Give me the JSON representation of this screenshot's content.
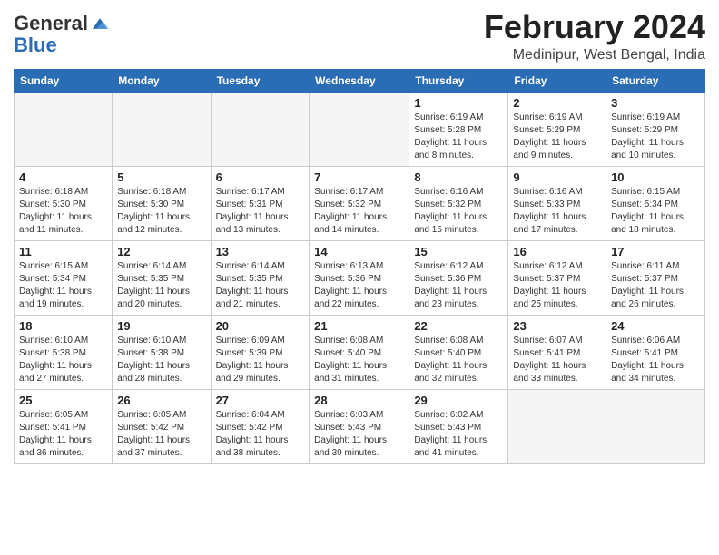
{
  "logo": {
    "general": "General",
    "blue": "Blue"
  },
  "title": "February 2024",
  "subtitle": "Medinipur, West Bengal, India",
  "days_of_week": [
    "Sunday",
    "Monday",
    "Tuesday",
    "Wednesday",
    "Thursday",
    "Friday",
    "Saturday"
  ],
  "weeks": [
    [
      {
        "day": "",
        "info": ""
      },
      {
        "day": "",
        "info": ""
      },
      {
        "day": "",
        "info": ""
      },
      {
        "day": "",
        "info": ""
      },
      {
        "day": "1",
        "info": "Sunrise: 6:19 AM\nSunset: 5:28 PM\nDaylight: 11 hours and 8 minutes."
      },
      {
        "day": "2",
        "info": "Sunrise: 6:19 AM\nSunset: 5:29 PM\nDaylight: 11 hours and 9 minutes."
      },
      {
        "day": "3",
        "info": "Sunrise: 6:19 AM\nSunset: 5:29 PM\nDaylight: 11 hours and 10 minutes."
      }
    ],
    [
      {
        "day": "4",
        "info": "Sunrise: 6:18 AM\nSunset: 5:30 PM\nDaylight: 11 hours and 11 minutes."
      },
      {
        "day": "5",
        "info": "Sunrise: 6:18 AM\nSunset: 5:30 PM\nDaylight: 11 hours and 12 minutes."
      },
      {
        "day": "6",
        "info": "Sunrise: 6:17 AM\nSunset: 5:31 PM\nDaylight: 11 hours and 13 minutes."
      },
      {
        "day": "7",
        "info": "Sunrise: 6:17 AM\nSunset: 5:32 PM\nDaylight: 11 hours and 14 minutes."
      },
      {
        "day": "8",
        "info": "Sunrise: 6:16 AM\nSunset: 5:32 PM\nDaylight: 11 hours and 15 minutes."
      },
      {
        "day": "9",
        "info": "Sunrise: 6:16 AM\nSunset: 5:33 PM\nDaylight: 11 hours and 17 minutes."
      },
      {
        "day": "10",
        "info": "Sunrise: 6:15 AM\nSunset: 5:34 PM\nDaylight: 11 hours and 18 minutes."
      }
    ],
    [
      {
        "day": "11",
        "info": "Sunrise: 6:15 AM\nSunset: 5:34 PM\nDaylight: 11 hours and 19 minutes."
      },
      {
        "day": "12",
        "info": "Sunrise: 6:14 AM\nSunset: 5:35 PM\nDaylight: 11 hours and 20 minutes."
      },
      {
        "day": "13",
        "info": "Sunrise: 6:14 AM\nSunset: 5:35 PM\nDaylight: 11 hours and 21 minutes."
      },
      {
        "day": "14",
        "info": "Sunrise: 6:13 AM\nSunset: 5:36 PM\nDaylight: 11 hours and 22 minutes."
      },
      {
        "day": "15",
        "info": "Sunrise: 6:12 AM\nSunset: 5:36 PM\nDaylight: 11 hours and 23 minutes."
      },
      {
        "day": "16",
        "info": "Sunrise: 6:12 AM\nSunset: 5:37 PM\nDaylight: 11 hours and 25 minutes."
      },
      {
        "day": "17",
        "info": "Sunrise: 6:11 AM\nSunset: 5:37 PM\nDaylight: 11 hours and 26 minutes."
      }
    ],
    [
      {
        "day": "18",
        "info": "Sunrise: 6:10 AM\nSunset: 5:38 PM\nDaylight: 11 hours and 27 minutes."
      },
      {
        "day": "19",
        "info": "Sunrise: 6:10 AM\nSunset: 5:38 PM\nDaylight: 11 hours and 28 minutes."
      },
      {
        "day": "20",
        "info": "Sunrise: 6:09 AM\nSunset: 5:39 PM\nDaylight: 11 hours and 29 minutes."
      },
      {
        "day": "21",
        "info": "Sunrise: 6:08 AM\nSunset: 5:40 PM\nDaylight: 11 hours and 31 minutes."
      },
      {
        "day": "22",
        "info": "Sunrise: 6:08 AM\nSunset: 5:40 PM\nDaylight: 11 hours and 32 minutes."
      },
      {
        "day": "23",
        "info": "Sunrise: 6:07 AM\nSunset: 5:41 PM\nDaylight: 11 hours and 33 minutes."
      },
      {
        "day": "24",
        "info": "Sunrise: 6:06 AM\nSunset: 5:41 PM\nDaylight: 11 hours and 34 minutes."
      }
    ],
    [
      {
        "day": "25",
        "info": "Sunrise: 6:05 AM\nSunset: 5:41 PM\nDaylight: 11 hours and 36 minutes."
      },
      {
        "day": "26",
        "info": "Sunrise: 6:05 AM\nSunset: 5:42 PM\nDaylight: 11 hours and 37 minutes."
      },
      {
        "day": "27",
        "info": "Sunrise: 6:04 AM\nSunset: 5:42 PM\nDaylight: 11 hours and 38 minutes."
      },
      {
        "day": "28",
        "info": "Sunrise: 6:03 AM\nSunset: 5:43 PM\nDaylight: 11 hours and 39 minutes."
      },
      {
        "day": "29",
        "info": "Sunrise: 6:02 AM\nSunset: 5:43 PM\nDaylight: 11 hours and 41 minutes."
      },
      {
        "day": "",
        "info": ""
      },
      {
        "day": "",
        "info": ""
      }
    ]
  ]
}
